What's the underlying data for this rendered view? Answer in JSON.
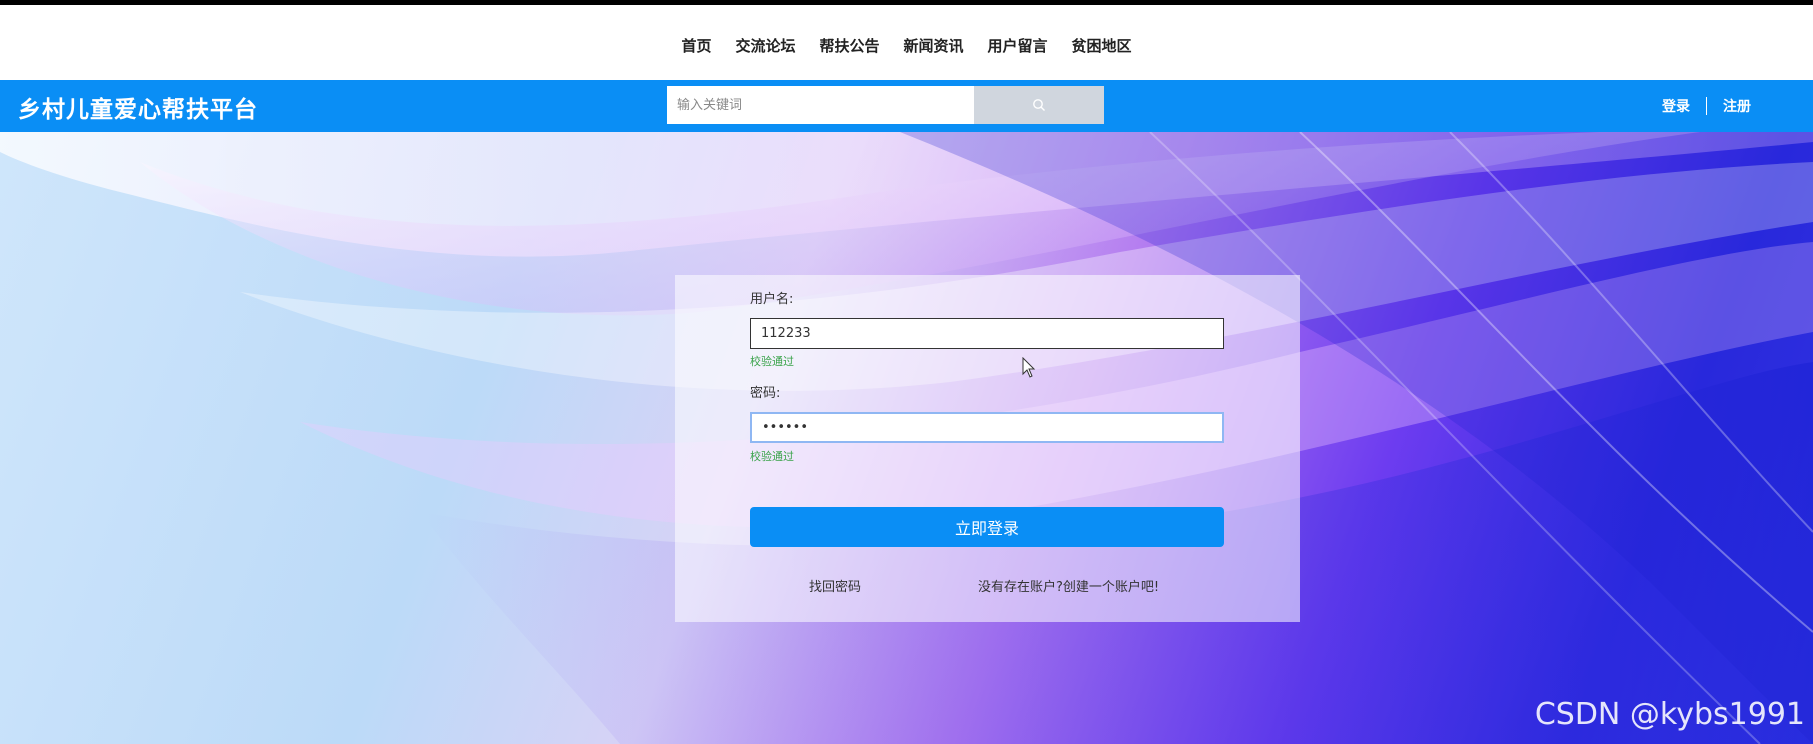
{
  "top_nav": {
    "items": [
      "首页",
      "交流论坛",
      "帮扶公告",
      "新闻资讯",
      "用户留言",
      "贫困地区"
    ]
  },
  "header": {
    "site_title": "乡村儿童爱心帮扶平台",
    "search_placeholder": "输入关键词",
    "search_icon": "search-icon",
    "login_link": "登录",
    "register_link": "注册"
  },
  "login_form": {
    "username_label": "用户名:",
    "username_value": "112233",
    "username_valid": "校验通过",
    "password_label": "密码:",
    "password_value": "••••••",
    "password_valid": "校验通过",
    "submit_label": "立即登录",
    "forgot_password": "找回密码",
    "register_prompt": "没有存在账户?创建一个账户吧!"
  },
  "watermark": "CSDN @kybs1991",
  "colors": {
    "brand_blue": "#0a8ef5",
    "valid_green": "#3aa34a",
    "search_button": "#d0d6de"
  }
}
